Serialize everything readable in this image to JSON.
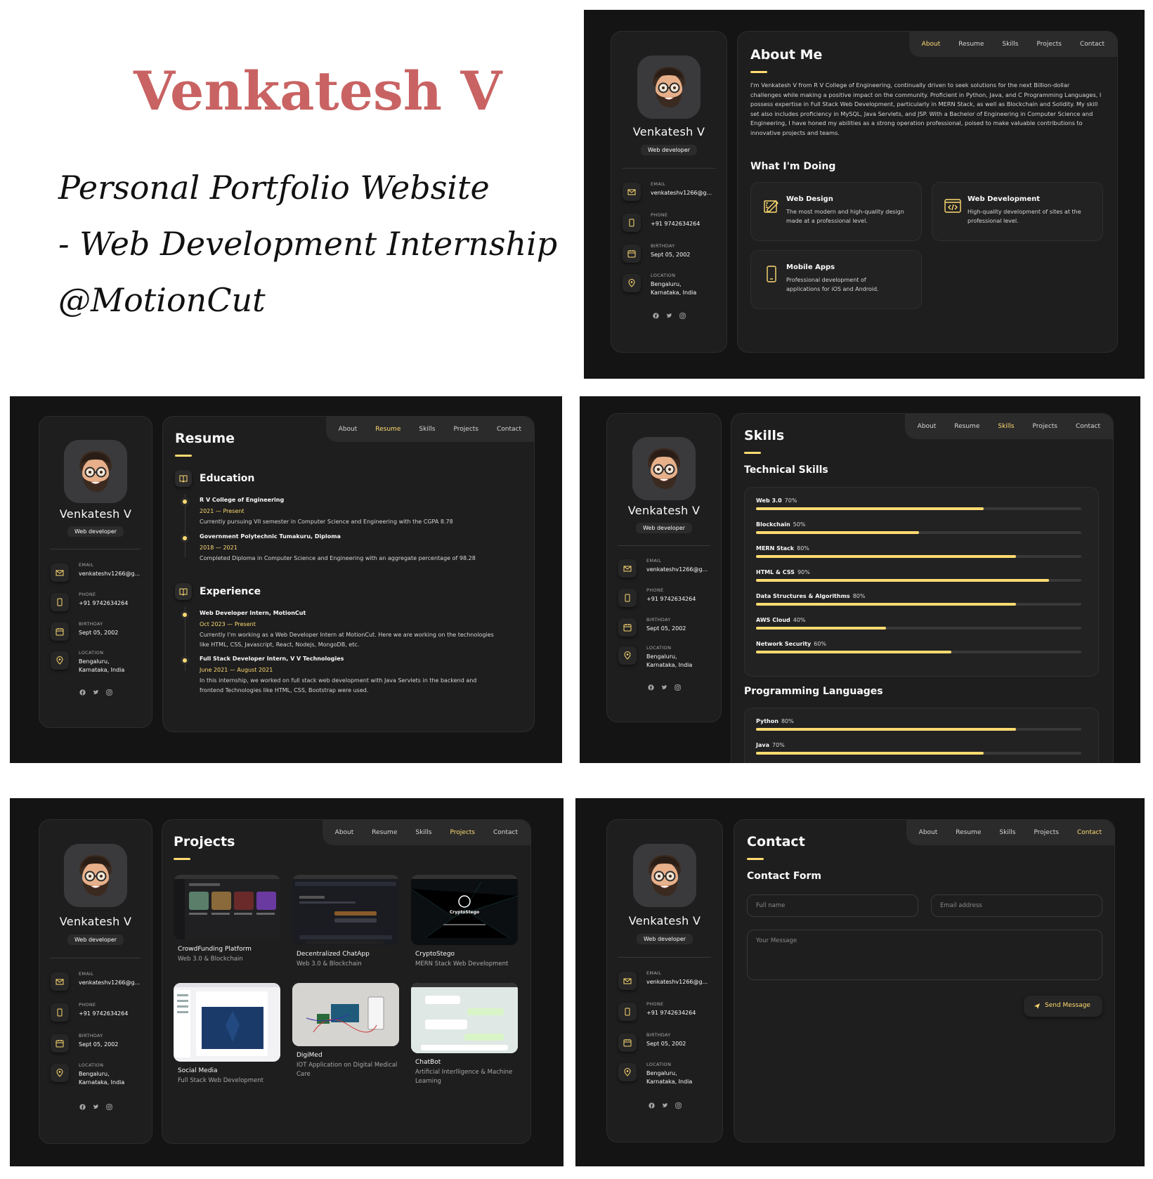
{
  "hero": {
    "title": "Venkatesh V",
    "line1": "Personal Portfolio Website",
    "line2": "- Web Development Internship",
    "line3": "@MotionCut"
  },
  "profile": {
    "name": "Venkatesh V",
    "role": "Web developer",
    "contacts": [
      {
        "icon": "mail-icon",
        "label": "EMAIL",
        "value": "venkateshv1266@g..."
      },
      {
        "icon": "phone-icon",
        "label": "PHONE",
        "value": "+91 9742634264"
      },
      {
        "icon": "calendar-icon",
        "label": "BIRTHDAY",
        "value": "Sept 05, 2002"
      },
      {
        "icon": "location-icon",
        "label": "LOCATION",
        "value": "Bengaluru,",
        "value2": "Karnataka, India"
      }
    ],
    "socials": [
      "facebook-icon",
      "twitter-icon",
      "instagram-icon"
    ]
  },
  "nav": {
    "about": "About",
    "resume": "Resume",
    "skills": "Skills",
    "projects": "Projects",
    "contact": "Contact"
  },
  "colors": {
    "accent": "#ffdb70",
    "bg": "#141414",
    "panel": "#1e1e1f",
    "hero_title": "#c96363"
  },
  "about": {
    "title": "About Me",
    "paragraph": "I'm Venkatesh V from R V College of Engineering, continually driven to seek solutions for the next Billion-dollar challenges while making a positive impact on the community. Proficient in Python, Java, and C Programming Languages, I possess expertise in Full Stack Web Development, particularly in MERN Stack, as well as Blockchain and Solidity. My skill set also includes proficiency in MySQL, Java Servlets, and JSP. With a Bachelor of Engineering in Computer Science and Engineering, I have honed my abilities as a strong operation professional, poised to make valuable contributions to innovative projects and teams.",
    "doing_title": "What I'm Doing",
    "services": [
      {
        "icon": "design-icon",
        "title": "Web Design",
        "desc": "The most modern and high-quality design made at a professional level."
      },
      {
        "icon": "code-icon",
        "title": "Web Development",
        "desc": "High-quality development of sites at the professional level."
      },
      {
        "icon": "mobile-icon",
        "title": "Mobile Apps",
        "desc": "Professional development of applications for iOS and Android."
      }
    ]
  },
  "resume": {
    "title": "Resume",
    "education_title": "Education",
    "education": [
      {
        "title": "R V College of Engineering",
        "date": "2021 — Present",
        "text": "Currently pursuing VII semester in Computer Science and Engineering with the CGPA 8.78"
      },
      {
        "title": "Government Polytechnic Tumakuru, Diploma",
        "date": "2018 — 2021",
        "text": "Completed Diploma in Computer Science and Engineering with an aggregate percentage of 98.28"
      }
    ],
    "experience_title": "Experience",
    "experience": [
      {
        "title": "Web Developer Intern, MotionCut",
        "date": "Oct 2023 — Present",
        "text": "Currently I'm working as a Web Developer Intern at MotionCut. Here we are working on the technologies like HTML, CSS, Javascript, React, Nodejs, MongoDB, etc."
      },
      {
        "title": "Full Stack Developer Intern, V V Technologies",
        "date": "June 2021 — August 2021",
        "text": "In this internship, we worked on full stack web development with Java Servlets in the backend and frontend Technologies like HTML, CSS, Bootstrap were used."
      }
    ]
  },
  "skills": {
    "title": "Skills",
    "technical_title": "Technical Skills",
    "technical": [
      {
        "name": "Web 3.0",
        "pct_label": "70%",
        "value": 70
      },
      {
        "name": "Blockchain",
        "pct_label": "50%",
        "value": 50
      },
      {
        "name": "MERN Stack",
        "pct_label": "80%",
        "value": 80
      },
      {
        "name": "HTML & CSS",
        "pct_label": "90%",
        "value": 90
      },
      {
        "name": "Data Structures & Algorithms",
        "pct_label": "80%",
        "value": 80
      },
      {
        "name": "AWS Cloud",
        "pct_label": "40%",
        "value": 40
      },
      {
        "name": "Network Security",
        "pct_label": "60%",
        "value": 60
      }
    ],
    "languages_title": "Programming Languages",
    "languages": [
      {
        "name": "Python",
        "pct_label": "80%",
        "value": 80
      },
      {
        "name": "Java",
        "pct_label": "70%",
        "value": 70
      }
    ]
  },
  "projects": {
    "title": "Projects",
    "items": [
      {
        "title": "CrowdFunding Platform",
        "category": "Web 3.0 & Blockchain"
      },
      {
        "title": "Decentralized ChatApp",
        "category": "Web 3.0 & Blockchain"
      },
      {
        "title": "CryptoStego",
        "category": "MERN Stack Web Development",
        "thumb_text": "CryptoStego"
      },
      {
        "title": "Social Media",
        "category": "Full Stack Web Development"
      },
      {
        "title": "DigiMed",
        "category": "IOT Application on Digital Medical Care"
      },
      {
        "title": "ChatBot",
        "category": "Artificial Interlligence & Machine Learning"
      }
    ]
  },
  "contact": {
    "title": "Contact",
    "form_title": "Contact Form",
    "fullname_placeholder": "Full name",
    "email_placeholder": "Email address",
    "message_placeholder": "Your Message",
    "send_label": "Send Message"
  }
}
